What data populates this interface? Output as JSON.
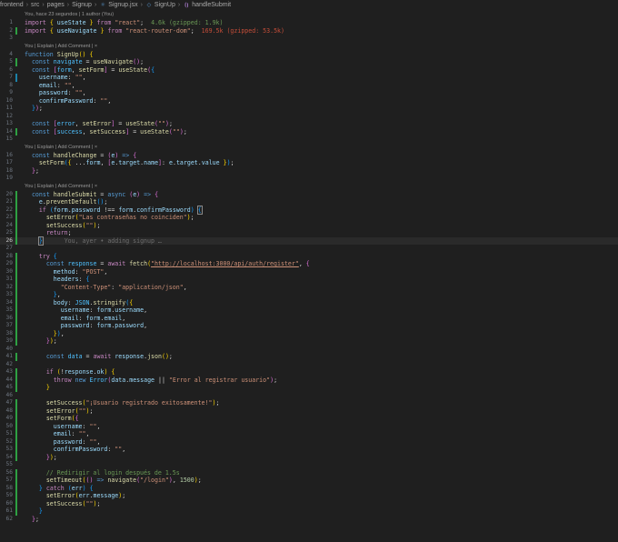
{
  "breadcrumb": {
    "items": [
      "frontend",
      "src",
      "pages",
      "Signup",
      "Signup.jsx",
      "SignUp",
      "handleSubmit"
    ]
  },
  "blame_top": "You, hace 23 segundos | 1 author (You)",
  "codelens": {
    "signup": "You | Explain | Add Comment | ×",
    "handleChange": "You | Explain | Add Comment | ×",
    "handleSubmit": "You | Explain | Add Comment | ×"
  },
  "import_hints": {
    "react": "4.6k (gzipped: 1.9k)",
    "router": "169.5k (gzipped: 53.5k)"
  },
  "inline_blame": "You, ayer • adding signup …",
  "strings": {
    "react": "\"react\"",
    "router": "\"react-router-dom\"",
    "empty": "\"\"",
    "mismatch": "\"Las contraseñas no coinciden\"",
    "url": "\"http://localhost:3000/api/auth/register\"",
    "post": "\"POST\"",
    "ctype_key": "\"Content-Type\"",
    "ctype_val": "\"application/json\"",
    "reg_error": "\"Error al registrar usuario\"",
    "reg_ok": "\"¡Usuario registrado exitosamente!\"",
    "login": "\"/login\""
  },
  "comment_redirect": "// Redirigir al login después de 1.5s",
  "numbers": {
    "timeout": "1500"
  }
}
